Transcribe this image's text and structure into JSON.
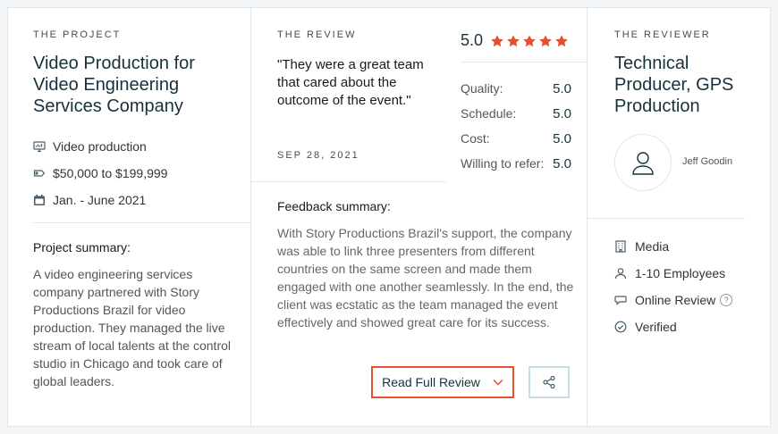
{
  "project": {
    "eyebrow": "THE PROJECT",
    "title": "Video Production for Video Engineering Services Company",
    "meta": [
      {
        "icon": "monitor-icon",
        "text": "Video production"
      },
      {
        "icon": "price-tag-icon",
        "text": "$50,000 to $199,999"
      },
      {
        "icon": "calendar-icon",
        "text": "Jan. - June 2021"
      }
    ],
    "summary_label": "Project summary:",
    "summary_text": "A video engineering services company partnered with Story Productions Brazil for video production. They managed the live stream of local talents at the control studio in Chicago and took care of global leaders."
  },
  "review": {
    "eyebrow": "THE REVIEW",
    "quote": "\"They were a great team that cared about the outcome of the event.\"",
    "date": "SEP 28, 2021",
    "overall": "5.0",
    "stars": 5,
    "star_color": "#e2522f",
    "scores": [
      {
        "label": "Quality:",
        "value": "5.0"
      },
      {
        "label": "Schedule:",
        "value": "5.0"
      },
      {
        "label": "Cost:",
        "value": "5.0"
      },
      {
        "label": "Willing to refer:",
        "value": "5.0"
      }
    ],
    "feedback_label": "Feedback summary:",
    "feedback_text": "With Story Productions Brazil's support, the company was able to link three presenters from different countries on the same screen and made them engaged with one another seamlessly. In the end, the client was ecstatic as the team managed the event effectively and showed great care for its success.",
    "read_full_label": "Read Full Review",
    "accent_color": "#e2522f"
  },
  "reviewer": {
    "eyebrow": "THE REVIEWER",
    "title": "Technical Producer, GPS Production",
    "name": "Jeff Goodin",
    "details": [
      {
        "icon": "building-icon",
        "text": "Media"
      },
      {
        "icon": "person-icon",
        "text": "1-10 Employees"
      },
      {
        "icon": "chat-bubble-icon",
        "text": "Online Review"
      },
      {
        "icon": "check-circle-icon",
        "text": "Verified"
      }
    ],
    "help_glyph": "?"
  }
}
